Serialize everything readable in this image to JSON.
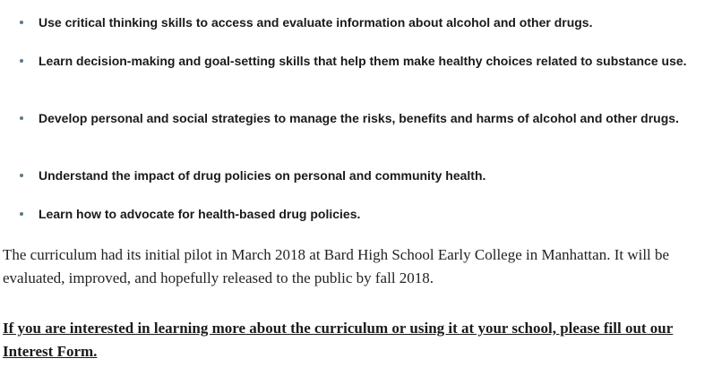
{
  "bullets": [
    "Use critical thinking skills to access and evaluate information about alcohol and other drugs.",
    "Learn decision-making and goal-setting skills that help them make healthy choices related to substance use.",
    "Develop personal and social strategies to manage the risks, benefits and harms of alcohol and other drugs.",
    "Understand the impact of drug policies on personal and community health.",
    "Learn how to advocate for health-based drug policies."
  ],
  "paragraph": "The curriculum had its initial pilot in March 2018 at Bard High School Early College in Manhattan. It will be evaluated, improved, and hopefully released to the public by fall 2018.",
  "cta_link": "If you are interested in learning more about the curriculum or using it at your school, please fill out our Interest Form."
}
